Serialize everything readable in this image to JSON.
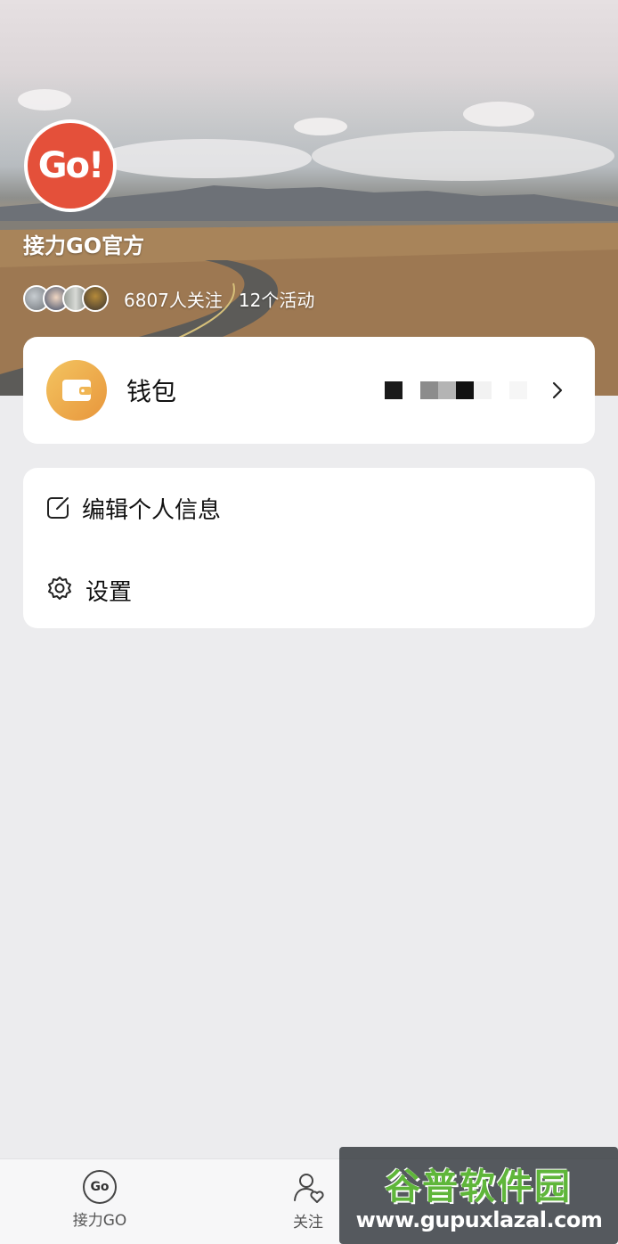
{
  "profile": {
    "avatar_text": "Go!",
    "name": "接力GO官方",
    "followers": "6807人关注",
    "activities": "12个活动"
  },
  "wallet": {
    "label": "钱包"
  },
  "menu": {
    "edit_profile": "编辑个人信息",
    "settings": "设置"
  },
  "tabbar": {
    "home_label": "接力GO",
    "home_icon_text": "Go",
    "follow_label": "关注"
  },
  "watermark": {
    "title": "谷普软件园",
    "url": "www.gupuxlazal.com"
  },
  "colors": {
    "brand_red": "#e4503a",
    "wallet_gradient_start": "#f3c460",
    "wallet_gradient_end": "#e8963c",
    "background": "#ececee"
  }
}
